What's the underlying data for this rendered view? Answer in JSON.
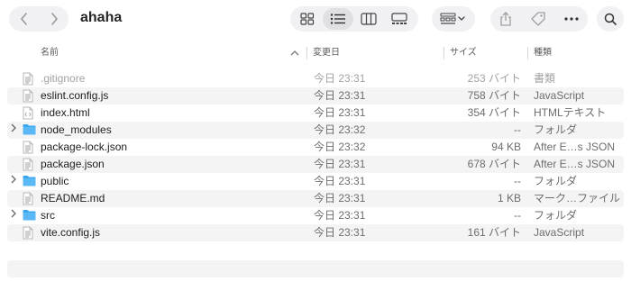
{
  "window": {
    "title": "ahaha"
  },
  "columns": {
    "name": "名前",
    "date": "変更日",
    "size": "サイズ",
    "kind": "種類"
  },
  "files": [
    {
      "name": ".gitignore",
      "date": "今日 23:31",
      "size": "253 バイト",
      "kind": "書類",
      "type": "doc",
      "dim": true
    },
    {
      "name": "eslint.config.js",
      "date": "今日 23:31",
      "size": "758 バイト",
      "kind": "JavaScript",
      "type": "doc"
    },
    {
      "name": "index.html",
      "date": "今日 23:31",
      "size": "354 バイト",
      "kind": "HTMLテキスト",
      "type": "html"
    },
    {
      "name": "node_modules",
      "date": "今日 23:32",
      "size": "--",
      "kind": "フォルダ",
      "type": "folder"
    },
    {
      "name": "package-lock.json",
      "date": "今日 23:32",
      "size": "94 KB",
      "kind": "After E…s JSON",
      "type": "doc"
    },
    {
      "name": "package.json",
      "date": "今日 23:31",
      "size": "678 バイト",
      "kind": "After E…s JSON",
      "type": "doc"
    },
    {
      "name": "public",
      "date": "今日 23:31",
      "size": "--",
      "kind": "フォルダ",
      "type": "folder"
    },
    {
      "name": "README.md",
      "date": "今日 23:31",
      "size": "1 KB",
      "kind": "マーク…ファイル",
      "type": "doc"
    },
    {
      "name": "src",
      "date": "今日 23:31",
      "size": "--",
      "kind": "フォルダ",
      "type": "folder"
    },
    {
      "name": "vite.config.js",
      "date": "今日 23:31",
      "size": "161 バイト",
      "kind": "JavaScript",
      "type": "doc"
    }
  ],
  "icons": {
    "back": "chevron-left-icon",
    "forward": "chevron-right-icon",
    "icon_view": "grid-icon",
    "list_view": "list-icon",
    "column_view": "columns-icon",
    "gallery_view": "gallery-icon",
    "group": "group-icon",
    "share": "share-icon",
    "tag": "tag-icon",
    "more": "ellipsis-icon",
    "search": "search-icon"
  },
  "colors": {
    "folder": "#39a7ef",
    "accent": "#0a84ff"
  }
}
